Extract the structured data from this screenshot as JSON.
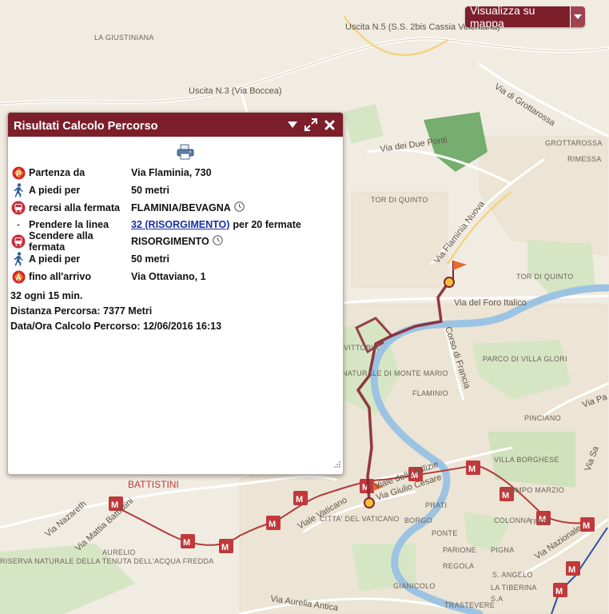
{
  "map": {
    "roads": [
      "Uscita N.5 (S.S. 2bis Cassia Veientana)",
      "Uscita N.3 (Via Boccea)",
      "Via di Grottarossa",
      "Via dei Due Ponti",
      "Via Flaminia Nuova",
      "Via del Foro Italico",
      "Corso di Francia",
      "Viale delle Milizie",
      "Via Giulio Cesare",
      "Viale Vaticano",
      "Via Nazareth",
      "Via Mattia Battistini",
      "Via Aurelia Antica",
      "Via Nazionale",
      "Via Pa",
      "Via Sa"
    ],
    "areas": [
      "LA GIUSTINIANA",
      "GROTTAROSSA",
      "RIMESSA",
      "TOR DI QUINTO",
      "TOR DI QUINTO",
      "FLAMINIO",
      "PARCO DI VILLA GLORI",
      "PINCIANO",
      "VILLA BORGHESE",
      "CAMPO MARZIO",
      "PRATI",
      "CITTA' DEL VATICANO",
      "BORGO",
      "PONTE",
      "PARIONE",
      "COLONNA",
      "PIGNA",
      "REGOLA",
      "S. ANGELO",
      "TREVI",
      "AURELIO",
      "GIANICOLO",
      "TRASTEVERE",
      "RISERVA NATURALE DELLA TENUTA DELL'ACQUA FREDDA",
      "NATURALE DI MONTE MARIO",
      "VITTORIA",
      "S.A",
      "LA TIBERINA"
    ],
    "metro_station": "BATTISTINI",
    "metro_icon": "metro-m-icon",
    "colors": {
      "land": "#f1ece2",
      "park": "#d6e6c4",
      "park_dark": "#5fa35a",
      "river": "#9cc3e3",
      "route": "#8a2330",
      "metro": "#c0393b"
    }
  },
  "view_button": {
    "label": "Visualizza su mappa",
    "caret_icon": "chevron-down-icon"
  },
  "panel": {
    "title": "Risultati Calcolo Percorso",
    "print_icon": "printer-icon",
    "steps": [
      {
        "icon": "start-p-icon",
        "key": "Partenza da",
        "value": "Via Flaminia, 730"
      },
      {
        "icon": "walk-icon",
        "key": "A piedi per",
        "value": "50 metri"
      },
      {
        "icon": "bus-stop-icon",
        "key": "recarsi alla fermata",
        "value": "FLAMINIA/BEVAGNA",
        "clock": true
      },
      {
        "icon": "dash",
        "key": "Prendere la linea",
        "link": "32 (RISORGIMENTO)",
        "suffix": "per 20 fermate"
      },
      {
        "icon": "bus-stop-icon",
        "key": "Scendere alla fermata",
        "value": "RISORGIMENTO",
        "clock": true
      },
      {
        "icon": "walk-icon",
        "key": "A piedi per",
        "value": "50 metri"
      },
      {
        "icon": "arrival-a-icon",
        "key": "fino all'arrivo",
        "value": "Via Ottaviano, 1"
      }
    ],
    "dash": "-",
    "frequency": "32 ogni 15 min.",
    "distance": "Distanza Percorsa: 7377 Metri",
    "datetime": "Data/Ora Calcolo Percorso: 12/06/2016 16:13"
  }
}
